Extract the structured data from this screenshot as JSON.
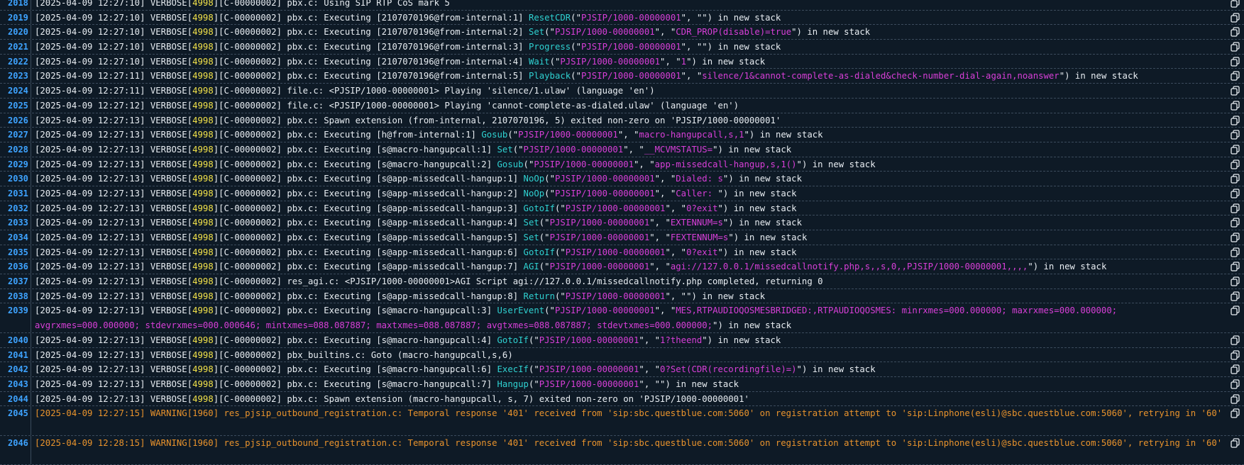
{
  "colors": {
    "background": "#0e1a26",
    "line_number": "#3ea3ff",
    "pid": "#f2e24a",
    "application": "#2fd1d1",
    "argument": "#d83fd8",
    "warning": "#e9932c",
    "default_text": "#e8edf2"
  },
  "icons": {
    "copy": "copy-icon"
  },
  "rows": [
    {
      "n": "2018",
      "style": "verbose",
      "segments": [
        {
          "t": "[2025-04-09 12:27:10] VERBOSE[",
          "c": "d"
        },
        {
          "t": "4998",
          "c": "p"
        },
        {
          "t": "][C-00000002] pbx.c: Using SIP RTP CoS mark 5",
          "c": "d"
        }
      ]
    },
    {
      "n": "2019",
      "style": "verbose",
      "segments": [
        {
          "t": "[2025-04-09 12:27:10] VERBOSE[",
          "c": "d"
        },
        {
          "t": "4998",
          "c": "p"
        },
        {
          "t": "][C-00000002] pbx.c: Executing [2107070196@from-internal:1] ",
          "c": "d"
        },
        {
          "t": "ResetCDR",
          "c": "a"
        },
        {
          "t": "(\"",
          "c": "d"
        },
        {
          "t": "PJSIP/1000-00000001",
          "c": "s"
        },
        {
          "t": "\", \"\") in new stack",
          "c": "d"
        }
      ]
    },
    {
      "n": "2020",
      "style": "verbose",
      "segments": [
        {
          "t": "[2025-04-09 12:27:10] VERBOSE[",
          "c": "d"
        },
        {
          "t": "4998",
          "c": "p"
        },
        {
          "t": "][C-00000002] pbx.c: Executing [2107070196@from-internal:2] ",
          "c": "d"
        },
        {
          "t": "Set",
          "c": "a"
        },
        {
          "t": "(\"",
          "c": "d"
        },
        {
          "t": "PJSIP/1000-00000001",
          "c": "s"
        },
        {
          "t": "\", \"",
          "c": "d"
        },
        {
          "t": "CDR_PROP(disable)=true",
          "c": "s"
        },
        {
          "t": "\") in new stack",
          "c": "d"
        }
      ]
    },
    {
      "n": "2021",
      "style": "verbose",
      "segments": [
        {
          "t": "[2025-04-09 12:27:10] VERBOSE[",
          "c": "d"
        },
        {
          "t": "4998",
          "c": "p"
        },
        {
          "t": "][C-00000002] pbx.c: Executing [2107070196@from-internal:3] ",
          "c": "d"
        },
        {
          "t": "Progress",
          "c": "a"
        },
        {
          "t": "(\"",
          "c": "d"
        },
        {
          "t": "PJSIP/1000-00000001",
          "c": "s"
        },
        {
          "t": "\", \"\") in new stack",
          "c": "d"
        }
      ]
    },
    {
      "n": "2022",
      "style": "verbose",
      "segments": [
        {
          "t": "[2025-04-09 12:27:10] VERBOSE[",
          "c": "d"
        },
        {
          "t": "4998",
          "c": "p"
        },
        {
          "t": "][C-00000002] pbx.c: Executing [2107070196@from-internal:4] ",
          "c": "d"
        },
        {
          "t": "Wait",
          "c": "a"
        },
        {
          "t": "(\"",
          "c": "d"
        },
        {
          "t": "PJSIP/1000-00000001",
          "c": "s"
        },
        {
          "t": "\", \"",
          "c": "d"
        },
        {
          "t": "1",
          "c": "s"
        },
        {
          "t": "\") in new stack",
          "c": "d"
        }
      ]
    },
    {
      "n": "2023",
      "style": "verbose",
      "segments": [
        {
          "t": "[2025-04-09 12:27:11] VERBOSE[",
          "c": "d"
        },
        {
          "t": "4998",
          "c": "p"
        },
        {
          "t": "][C-00000002] pbx.c: Executing [2107070196@from-internal:5] ",
          "c": "d"
        },
        {
          "t": "Playback",
          "c": "a"
        },
        {
          "t": "(\"",
          "c": "d"
        },
        {
          "t": "PJSIP/1000-00000001",
          "c": "s"
        },
        {
          "t": "\", \"",
          "c": "d"
        },
        {
          "t": "silence/1&cannot-complete-as-dialed&check-number-dial-again,noanswer",
          "c": "s"
        },
        {
          "t": "\") in new stack",
          "c": "d"
        }
      ]
    },
    {
      "n": "2024",
      "style": "verbose",
      "segments": [
        {
          "t": "[2025-04-09 12:27:11] VERBOSE[",
          "c": "d"
        },
        {
          "t": "4998",
          "c": "p"
        },
        {
          "t": "][C-00000002] file.c: <PJSIP/1000-00000001> Playing 'silence/1.ulaw' (language 'en')",
          "c": "d"
        }
      ]
    },
    {
      "n": "2025",
      "style": "verbose",
      "segments": [
        {
          "t": "[2025-04-09 12:27:12] VERBOSE[",
          "c": "d"
        },
        {
          "t": "4998",
          "c": "p"
        },
        {
          "t": "][C-00000002] file.c: <PJSIP/1000-00000001> Playing 'cannot-complete-as-dialed.ulaw' (language 'en')",
          "c": "d"
        }
      ]
    },
    {
      "n": "2026",
      "style": "verbose",
      "segments": [
        {
          "t": "[2025-04-09 12:27:13] VERBOSE[",
          "c": "d"
        },
        {
          "t": "4998",
          "c": "p"
        },
        {
          "t": "][C-00000002] pbx.c: Spawn extension (from-internal, 2107070196, 5) exited non-zero on 'PJSIP/1000-00000001'",
          "c": "d"
        }
      ]
    },
    {
      "n": "2027",
      "style": "verbose",
      "segments": [
        {
          "t": "[2025-04-09 12:27:13] VERBOSE[",
          "c": "d"
        },
        {
          "t": "4998",
          "c": "p"
        },
        {
          "t": "][C-00000002] pbx.c: Executing [h@from-internal:1] ",
          "c": "d"
        },
        {
          "t": "Gosub",
          "c": "a"
        },
        {
          "t": "(\"",
          "c": "d"
        },
        {
          "t": "PJSIP/1000-00000001",
          "c": "s"
        },
        {
          "t": "\", \"",
          "c": "d"
        },
        {
          "t": "macro-hangupcall,s,1",
          "c": "s"
        },
        {
          "t": "\") in new stack",
          "c": "d"
        }
      ]
    },
    {
      "n": "2028",
      "style": "verbose",
      "segments": [
        {
          "t": "[2025-04-09 12:27:13] VERBOSE[",
          "c": "d"
        },
        {
          "t": "4998",
          "c": "p"
        },
        {
          "t": "][C-00000002] pbx.c: Executing [s@macro-hangupcall:1] ",
          "c": "d"
        },
        {
          "t": "Set",
          "c": "a"
        },
        {
          "t": "(\"",
          "c": "d"
        },
        {
          "t": "PJSIP/1000-00000001",
          "c": "s"
        },
        {
          "t": "\", \"",
          "c": "d"
        },
        {
          "t": "__MCVMSTATUS=",
          "c": "s"
        },
        {
          "t": "\") in new stack",
          "c": "d"
        }
      ]
    },
    {
      "n": "2029",
      "style": "verbose",
      "segments": [
        {
          "t": "[2025-04-09 12:27:13] VERBOSE[",
          "c": "d"
        },
        {
          "t": "4998",
          "c": "p"
        },
        {
          "t": "][C-00000002] pbx.c: Executing [s@macro-hangupcall:2] ",
          "c": "d"
        },
        {
          "t": "Gosub",
          "c": "a"
        },
        {
          "t": "(\"",
          "c": "d"
        },
        {
          "t": "PJSIP/1000-00000001",
          "c": "s"
        },
        {
          "t": "\", \"",
          "c": "d"
        },
        {
          "t": "app-missedcall-hangup,s,1()",
          "c": "s"
        },
        {
          "t": "\") in new stack",
          "c": "d"
        }
      ]
    },
    {
      "n": "2030",
      "style": "verbose",
      "segments": [
        {
          "t": "[2025-04-09 12:27:13] VERBOSE[",
          "c": "d"
        },
        {
          "t": "4998",
          "c": "p"
        },
        {
          "t": "][C-00000002] pbx.c: Executing [s@app-missedcall-hangup:1] ",
          "c": "d"
        },
        {
          "t": "NoOp",
          "c": "a"
        },
        {
          "t": "(\"",
          "c": "d"
        },
        {
          "t": "PJSIP/1000-00000001",
          "c": "s"
        },
        {
          "t": "\", \"",
          "c": "d"
        },
        {
          "t": "Dialed: s",
          "c": "s"
        },
        {
          "t": "\") in new stack",
          "c": "d"
        }
      ]
    },
    {
      "n": "2031",
      "style": "verbose",
      "segments": [
        {
          "t": "[2025-04-09 12:27:13] VERBOSE[",
          "c": "d"
        },
        {
          "t": "4998",
          "c": "p"
        },
        {
          "t": "][C-00000002] pbx.c: Executing [s@app-missedcall-hangup:2] ",
          "c": "d"
        },
        {
          "t": "NoOp",
          "c": "a"
        },
        {
          "t": "(\"",
          "c": "d"
        },
        {
          "t": "PJSIP/1000-00000001",
          "c": "s"
        },
        {
          "t": "\", \"",
          "c": "d"
        },
        {
          "t": "Caller: ",
          "c": "s"
        },
        {
          "t": "\") in new stack",
          "c": "d"
        }
      ]
    },
    {
      "n": "2032",
      "style": "verbose",
      "segments": [
        {
          "t": "[2025-04-09 12:27:13] VERBOSE[",
          "c": "d"
        },
        {
          "t": "4998",
          "c": "p"
        },
        {
          "t": "][C-00000002] pbx.c: Executing [s@app-missedcall-hangup:3] ",
          "c": "d"
        },
        {
          "t": "GotoIf",
          "c": "a"
        },
        {
          "t": "(\"",
          "c": "d"
        },
        {
          "t": "PJSIP/1000-00000001",
          "c": "s"
        },
        {
          "t": "\", \"",
          "c": "d"
        },
        {
          "t": "0?exit",
          "c": "s"
        },
        {
          "t": "\") in new stack",
          "c": "d"
        }
      ]
    },
    {
      "n": "2033",
      "style": "verbose",
      "segments": [
        {
          "t": "[2025-04-09 12:27:13] VERBOSE[",
          "c": "d"
        },
        {
          "t": "4998",
          "c": "p"
        },
        {
          "t": "][C-00000002] pbx.c: Executing [s@app-missedcall-hangup:4] ",
          "c": "d"
        },
        {
          "t": "Set",
          "c": "a"
        },
        {
          "t": "(\"",
          "c": "d"
        },
        {
          "t": "PJSIP/1000-00000001",
          "c": "s"
        },
        {
          "t": "\", \"",
          "c": "d"
        },
        {
          "t": "EXTENNUM=s",
          "c": "s"
        },
        {
          "t": "\") in new stack",
          "c": "d"
        }
      ]
    },
    {
      "n": "2034",
      "style": "verbose",
      "segments": [
        {
          "t": "[2025-04-09 12:27:13] VERBOSE[",
          "c": "d"
        },
        {
          "t": "4998",
          "c": "p"
        },
        {
          "t": "][C-00000002] pbx.c: Executing [s@app-missedcall-hangup:5] ",
          "c": "d"
        },
        {
          "t": "Set",
          "c": "a"
        },
        {
          "t": "(\"",
          "c": "d"
        },
        {
          "t": "PJSIP/1000-00000001",
          "c": "s"
        },
        {
          "t": "\", \"",
          "c": "d"
        },
        {
          "t": "FEXTENNUM=s",
          "c": "s"
        },
        {
          "t": "\") in new stack",
          "c": "d"
        }
      ]
    },
    {
      "n": "2035",
      "style": "verbose",
      "segments": [
        {
          "t": "[2025-04-09 12:27:13] VERBOSE[",
          "c": "d"
        },
        {
          "t": "4998",
          "c": "p"
        },
        {
          "t": "][C-00000002] pbx.c: Executing [s@app-missedcall-hangup:6] ",
          "c": "d"
        },
        {
          "t": "GotoIf",
          "c": "a"
        },
        {
          "t": "(\"",
          "c": "d"
        },
        {
          "t": "PJSIP/1000-00000001",
          "c": "s"
        },
        {
          "t": "\", \"",
          "c": "d"
        },
        {
          "t": "0?exit",
          "c": "s"
        },
        {
          "t": "\") in new stack",
          "c": "d"
        }
      ]
    },
    {
      "n": "2036",
      "style": "verbose",
      "segments": [
        {
          "t": "[2025-04-09 12:27:13] VERBOSE[",
          "c": "d"
        },
        {
          "t": "4998",
          "c": "p"
        },
        {
          "t": "][C-00000002] pbx.c: Executing [s@app-missedcall-hangup:7] ",
          "c": "d"
        },
        {
          "t": "AGI",
          "c": "a"
        },
        {
          "t": "(\"",
          "c": "d"
        },
        {
          "t": "PJSIP/1000-00000001",
          "c": "s"
        },
        {
          "t": "\", \"",
          "c": "d"
        },
        {
          "t": "agi://127.0.0.1/missedcallnotify.php,s,,s,0,,PJSIP/1000-00000001,,,,",
          "c": "s"
        },
        {
          "t": "\") in new stack",
          "c": "d"
        }
      ]
    },
    {
      "n": "2037",
      "style": "verbose",
      "segments": [
        {
          "t": "[2025-04-09 12:27:13] VERBOSE[",
          "c": "d"
        },
        {
          "t": "4998",
          "c": "p"
        },
        {
          "t": "][C-00000002] res_agi.c: <PJSIP/1000-00000001>AGI Script agi://127.0.0.1/missedcallnotify.php completed, returning 0",
          "c": "d"
        }
      ]
    },
    {
      "n": "2038",
      "style": "verbose",
      "segments": [
        {
          "t": "[2025-04-09 12:27:13] VERBOSE[",
          "c": "d"
        },
        {
          "t": "4998",
          "c": "p"
        },
        {
          "t": "][C-00000002] pbx.c: Executing [s@app-missedcall-hangup:8] ",
          "c": "d"
        },
        {
          "t": "Return",
          "c": "a"
        },
        {
          "t": "(\"",
          "c": "d"
        },
        {
          "t": "PJSIP/1000-00000001",
          "c": "s"
        },
        {
          "t": "\", \"\") in new stack",
          "c": "d"
        }
      ]
    },
    {
      "n": "2039",
      "style": "verbose",
      "double": true,
      "segments": [
        {
          "t": "[2025-04-09 12:27:13] VERBOSE[",
          "c": "d"
        },
        {
          "t": "4998",
          "c": "p"
        },
        {
          "t": "][C-00000002] pbx.c: Executing [s@macro-hangupcall:3] ",
          "c": "d"
        },
        {
          "t": "UserEvent",
          "c": "a"
        },
        {
          "t": "(\"",
          "c": "d"
        },
        {
          "t": "PJSIP/1000-00000001",
          "c": "s"
        },
        {
          "t": "\", \"",
          "c": "d"
        },
        {
          "t": "MES,RTPAUDIOQOSMESBRIDGED:,RTPAUDIOQOSMES: minrxmes=000.000000; maxrxmes=000.000000; avgrxmes=000.000000; stdevrxmes=000.000646; mintxmes=088.087887; maxtxmes=088.087887; avgtxmes=088.087887; stdevtxmes=000.000000;",
          "c": "s"
        },
        {
          "t": "\") in new stack",
          "c": "d"
        }
      ]
    },
    {
      "n": "2040",
      "style": "verbose",
      "segments": [
        {
          "t": "[2025-04-09 12:27:13] VERBOSE[",
          "c": "d"
        },
        {
          "t": "4998",
          "c": "p"
        },
        {
          "t": "][C-00000002] pbx.c: Executing [s@macro-hangupcall:4] ",
          "c": "d"
        },
        {
          "t": "GotoIf",
          "c": "a"
        },
        {
          "t": "(\"",
          "c": "d"
        },
        {
          "t": "PJSIP/1000-00000001",
          "c": "s"
        },
        {
          "t": "\", \"",
          "c": "d"
        },
        {
          "t": "1?theend",
          "c": "s"
        },
        {
          "t": "\") in new stack",
          "c": "d"
        }
      ]
    },
    {
      "n": "2041",
      "style": "verbose",
      "segments": [
        {
          "t": "[2025-04-09 12:27:13] VERBOSE[",
          "c": "d"
        },
        {
          "t": "4998",
          "c": "p"
        },
        {
          "t": "][C-00000002] pbx_builtins.c: Goto (macro-hangupcall,s,6)",
          "c": "d"
        }
      ]
    },
    {
      "n": "2042",
      "style": "verbose",
      "segments": [
        {
          "t": "[2025-04-09 12:27:13] VERBOSE[",
          "c": "d"
        },
        {
          "t": "4998",
          "c": "p"
        },
        {
          "t": "][C-00000002] pbx.c: Executing [s@macro-hangupcall:6] ",
          "c": "d"
        },
        {
          "t": "ExecIf",
          "c": "a"
        },
        {
          "t": "(\"",
          "c": "d"
        },
        {
          "t": "PJSIP/1000-00000001",
          "c": "s"
        },
        {
          "t": "\", \"",
          "c": "d"
        },
        {
          "t": "0?Set(CDR(recordingfile)=)",
          "c": "s"
        },
        {
          "t": "\") in new stack",
          "c": "d"
        }
      ]
    },
    {
      "n": "2043",
      "style": "verbose",
      "segments": [
        {
          "t": "[2025-04-09 12:27:13] VERBOSE[",
          "c": "d"
        },
        {
          "t": "4998",
          "c": "p"
        },
        {
          "t": "][C-00000002] pbx.c: Executing [s@macro-hangupcall:7] ",
          "c": "d"
        },
        {
          "t": "Hangup",
          "c": "a"
        },
        {
          "t": "(\"",
          "c": "d"
        },
        {
          "t": "PJSIP/1000-00000001",
          "c": "s"
        },
        {
          "t": "\", \"\") in new stack",
          "c": "d"
        }
      ]
    },
    {
      "n": "2044",
      "style": "verbose",
      "segments": [
        {
          "t": "[2025-04-09 12:27:13] VERBOSE[",
          "c": "d"
        },
        {
          "t": "4998",
          "c": "p"
        },
        {
          "t": "][C-00000002] pbx.c: Spawn extension (macro-hangupcall, s, 7) exited non-zero on 'PJSIP/1000-00000001'",
          "c": "d"
        }
      ]
    },
    {
      "n": "2045",
      "style": "warning",
      "double": true,
      "segments": [
        {
          "t": "[2025-04-09 12:27:15] WARNING[1960] res_pjsip_outbound_registration.c: Temporal response '401' received from 'sip:sbc.questblue.com:5060' on registration attempt to 'sip:Linphone(esli)@sbc.questblue.com:5060', retrying in '60'",
          "c": "w"
        }
      ]
    },
    {
      "n": "2046",
      "style": "warning",
      "double": true,
      "segments": [
        {
          "t": "[2025-04-09 12:28:15] WARNING[1960] res_pjsip_outbound_registration.c: Temporal response '401' received from 'sip:sbc.questblue.com:5060' on registration attempt to 'sip:Linphone(esli)@sbc.questblue.com:5060', retrying in '60'",
          "c": "w"
        }
      ]
    }
  ]
}
